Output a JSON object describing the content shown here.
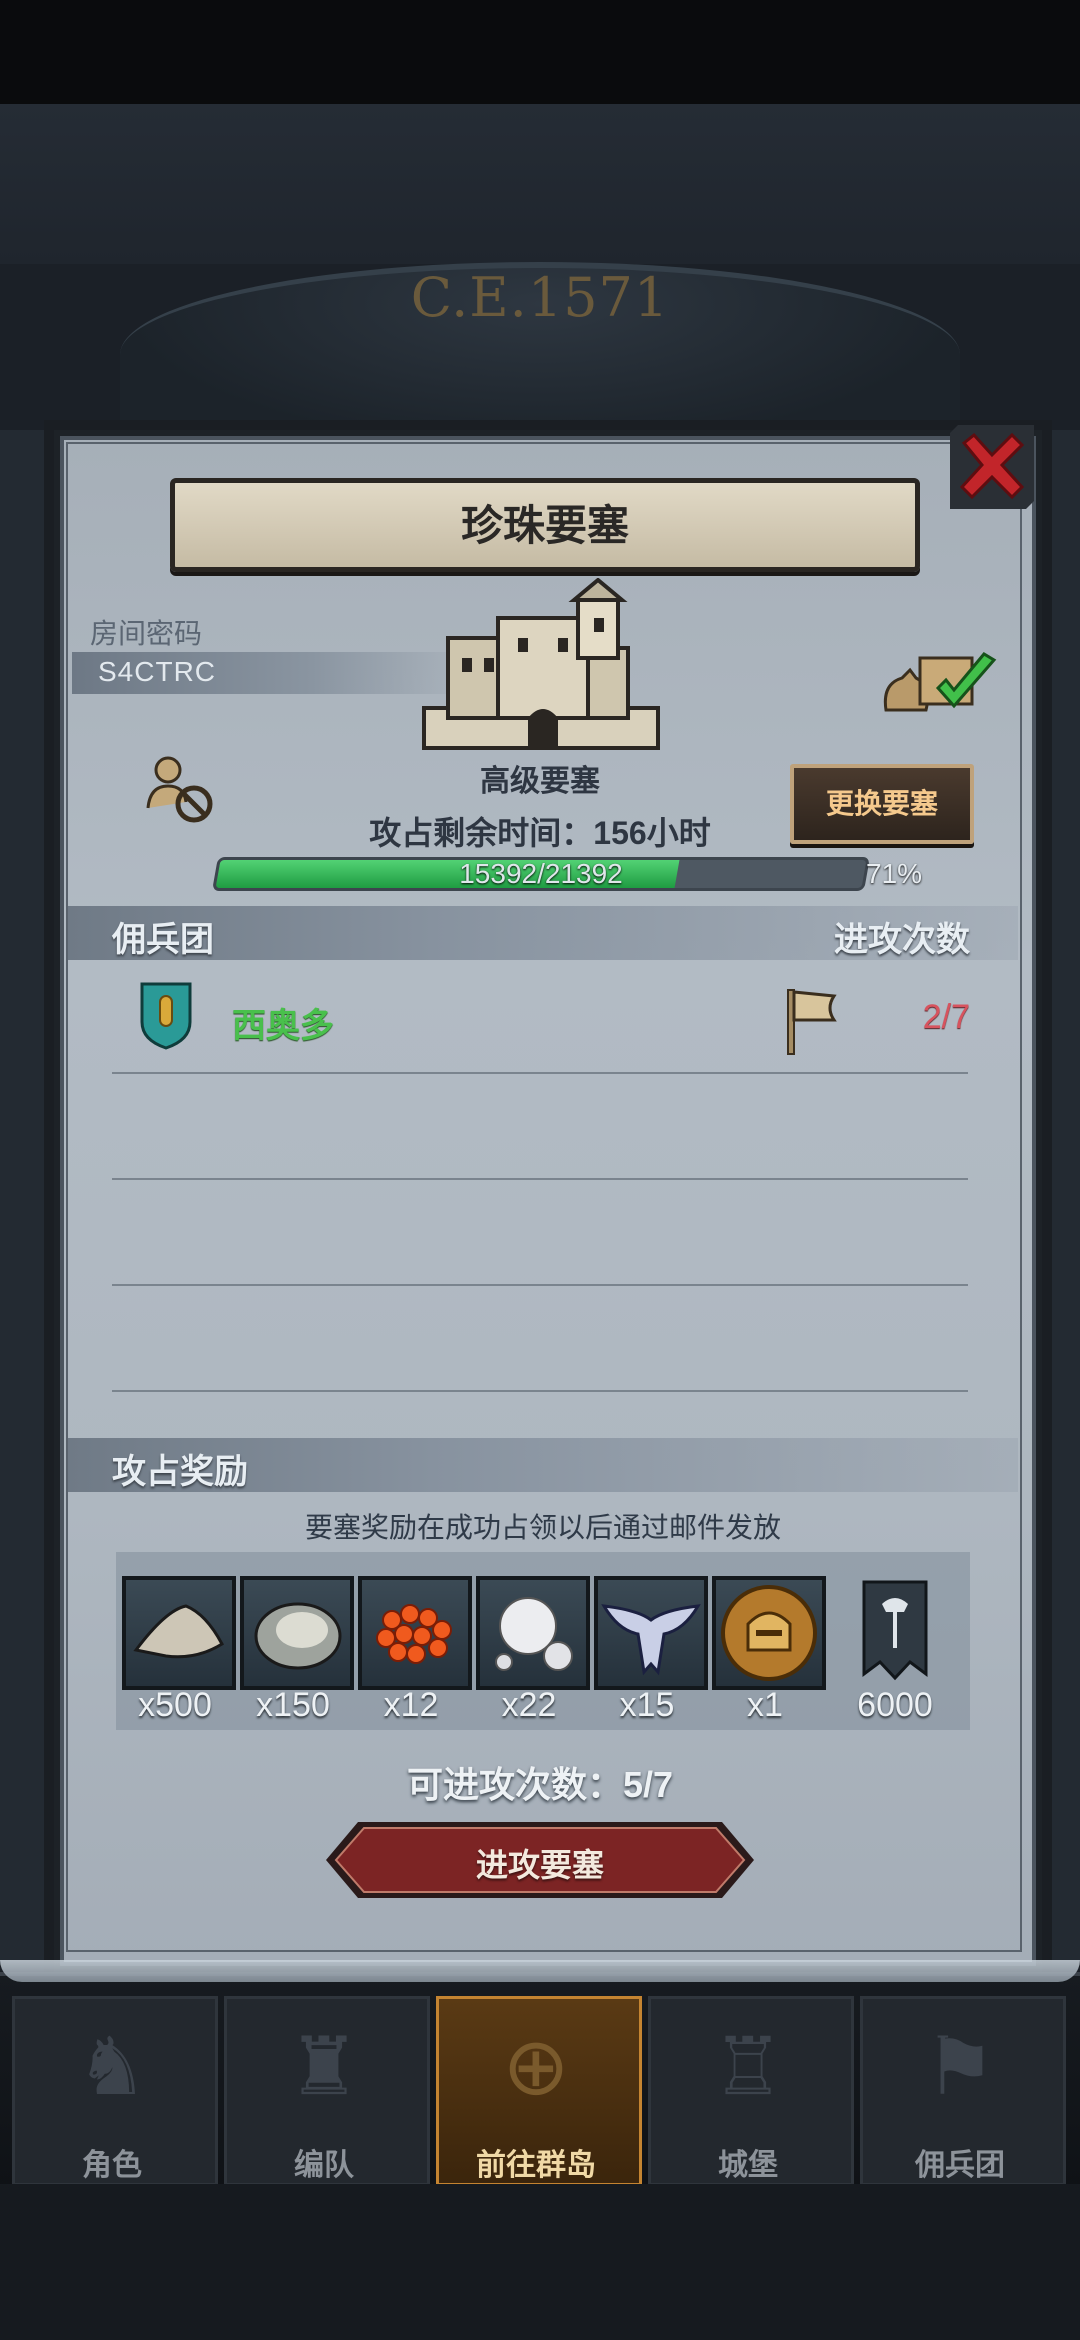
{
  "background": {
    "era_text": "C.E.1571"
  },
  "dialog": {
    "title": "珍珠要塞",
    "room_label": "房间密码",
    "room_code": "S4CTRC",
    "castle_level": "高级要塞",
    "change_button": "更换要塞",
    "remaining_time": "攻占剩余时间：156小时",
    "progress": {
      "text": "15392/21392",
      "percent_text": "71%",
      "fraction": 0.71
    }
  },
  "mercenary_section": {
    "left_label": "佣兵团",
    "right_label": "进攻次数",
    "rows": [
      {
        "name": "西奥多",
        "count": "2/7"
      }
    ]
  },
  "reward_section": {
    "label": "攻占奖励",
    "note": "要塞奖励在成功占领以后通过邮件发放",
    "items": [
      {
        "icon": "sand-icon",
        "count": "x500"
      },
      {
        "icon": "oyster-icon",
        "count": "x150"
      },
      {
        "icon": "roe-icon",
        "count": "x12"
      },
      {
        "icon": "pearl-icon",
        "count": "x22"
      },
      {
        "icon": "wings-emblem-icon",
        "count": "x15"
      },
      {
        "icon": "knight-helmet-coin-icon",
        "count": "x1"
      },
      {
        "icon": "axe-banner-icon",
        "count": "6000"
      }
    ],
    "attacks_left": "可进攻次数：5/7",
    "attack_button": "进攻要塞"
  },
  "bottom_nav": {
    "items": [
      "角色",
      "编队",
      "前往群岛",
      "城堡",
      "佣兵团"
    ],
    "active": "前往群岛"
  },
  "colors": {
    "progress_fill": "#2fb255",
    "merc_name": "#49c04c",
    "attack_count": "#d7535e",
    "attack_button": "#7c2424"
  }
}
